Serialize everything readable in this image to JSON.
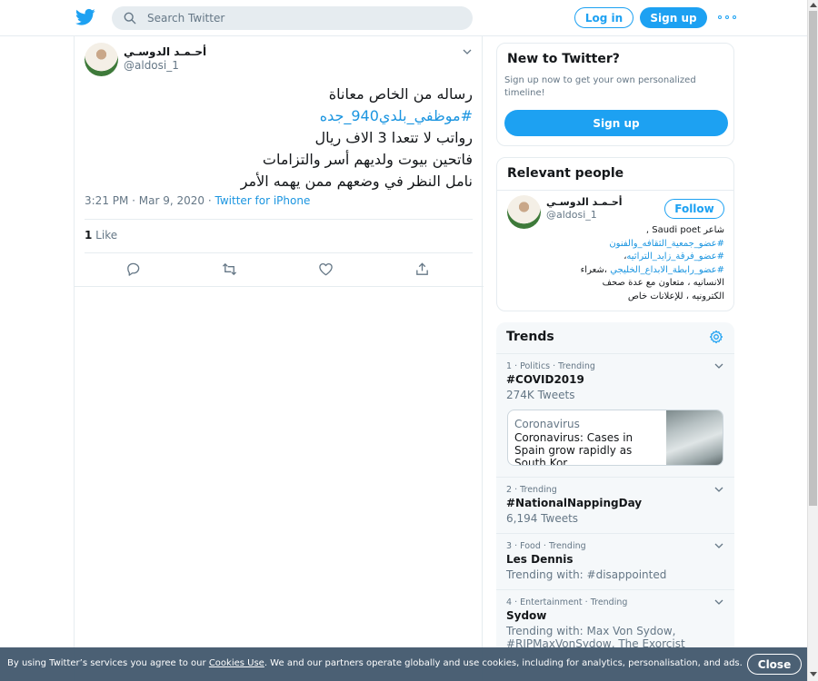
{
  "header": {
    "search_placeholder": "Search Twitter",
    "login_label": "Log in",
    "signup_label": "Sign up"
  },
  "tweet": {
    "author_name": "أحـمـد الدوسـي",
    "author_handle": "@aldosi_1",
    "lines": [
      "رساله من الخاص معاناة",
      "#موظفي_بلدي940_جده",
      "رواتب لا تتعدا 3 الاف ريال",
      "فاتحين بيوت ولديهم أسر والتزامات",
      "نامل النظر في وضعهم ممن يهمه الأمر"
    ],
    "timestamp": "3:21 PM · Mar 9, 2020 · ",
    "source": "Twitter for iPhone",
    "like_count": "1",
    "like_label": " Like"
  },
  "new_to_twitter": {
    "title": "New to Twitter?",
    "text": "Sign up now to get your own personalized timeline!",
    "button": "Sign up"
  },
  "relevant_people": {
    "title": "Relevant people",
    "name": "أحـمـد الدوسـي",
    "handle": "@aldosi_1",
    "follow_label": "Follow",
    "bio_line1": "شاعر Saudi poet ,",
    "bio_tag1": "#عضو_جمعية_الثقافه_والفنون",
    "bio_tag2": "#عضو_فرقة_زايد_التراثيه",
    "bio_tag2_suffix": "،",
    "bio_tag3": "#عضو_رابطة_الابداع_الخليجي",
    "bio_tag3_suffix": " ،شعراء",
    "bio_line4": "الانسانيه ، متعاون مع عدة صحف",
    "bio_line5": "الكترونيه ، للإعلانات خاص"
  },
  "trends": {
    "title": "Trends",
    "items": [
      {
        "meta": "1 · Politics · Trending",
        "name": "#COVID2019",
        "sub": "274K Tweets"
      },
      {
        "meta": "2 · Trending",
        "name": "#NationalNappingDay",
        "sub": "6,194 Tweets"
      },
      {
        "meta": "3 · Food · Trending",
        "name": "Les Dennis",
        "sub": "Trending with: #disappointed"
      },
      {
        "meta": "4 · Entertainment · Trending",
        "name": "Sydow",
        "sub": "Trending with: Max Von Sydow, #RIPMaxVonSydow, The Exorcist"
      }
    ],
    "news": {
      "category": "Coronavirus",
      "title": "Coronavirus: Cases in Spain grow rapidly as South Kor…"
    }
  },
  "cookie": {
    "text_before": "By using Twitter’s services you agree to our ",
    "link": "Cookies Use",
    "text_after": ". We and our partners operate globally and use cookies, including for analytics, personalisation, and ads.",
    "close_label": "Close"
  },
  "colors": {
    "brand_blue": "#1da1f2",
    "link_blue": "#1b95e0",
    "cookie_bar": "#445a6e"
  }
}
